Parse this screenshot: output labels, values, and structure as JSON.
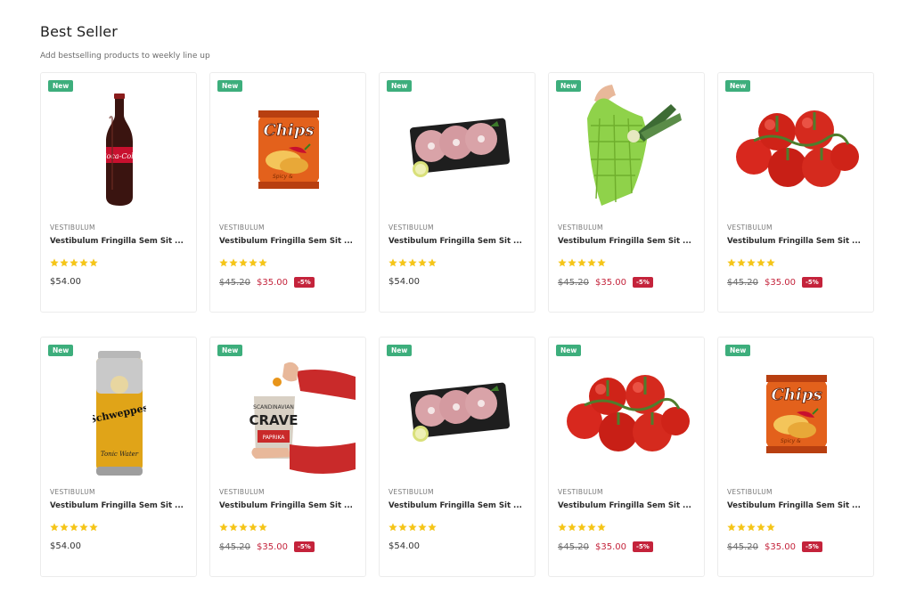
{
  "section": {
    "title": "Best Seller",
    "subtitle": "Add bestselling products to weekly line up"
  },
  "colors": {
    "new_badge": "#3dae7c",
    "sale": "#c4233b",
    "star": "#f5c518"
  },
  "products": [
    {
      "badge": "New",
      "image": "cola-bottle",
      "vendor": "VESTIBULUM",
      "name": "Vestibulum Fringilla Sem Sit ...",
      "rating": 5,
      "price": "$54.00",
      "old_price": "",
      "sale_price": "",
      "discount": ""
    },
    {
      "badge": "New",
      "image": "chips-bag",
      "vendor": "VESTIBULUM",
      "name": "Vestibulum Fringilla Sem Sit ...",
      "rating": 5,
      "price": "",
      "old_price": "$45.20",
      "sale_price": "$35.00",
      "discount": "-5%"
    },
    {
      "badge": "New",
      "image": "fish-steaks-tray",
      "vendor": "VESTIBULUM",
      "name": "Vestibulum Fringilla Sem Sit ...",
      "rating": 5,
      "price": "$54.00",
      "old_price": "",
      "sale_price": "",
      "discount": ""
    },
    {
      "badge": "New",
      "image": "mesh-grocery-bag",
      "vendor": "VESTIBULUM",
      "name": "Vestibulum Fringilla Sem Sit ...",
      "rating": 5,
      "price": "",
      "old_price": "$45.20",
      "sale_price": "$35.00",
      "discount": "-5%"
    },
    {
      "badge": "New",
      "image": "tomatoes-on-vine",
      "vendor": "VESTIBULUM",
      "name": "Vestibulum Fringilla Sem Sit ...",
      "rating": 5,
      "price": "",
      "old_price": "$45.20",
      "sale_price": "$35.00",
      "discount": "-5%"
    },
    {
      "badge": "New",
      "image": "schweppes-can",
      "vendor": "VESTIBULUM",
      "name": "Vestibulum Fringilla Sem Sit ...",
      "rating": 5,
      "price": "$54.00",
      "old_price": "",
      "sale_price": "",
      "discount": ""
    },
    {
      "badge": "New",
      "image": "crave-chips-hands",
      "vendor": "VESTIBULUM",
      "name": "Vestibulum Fringilla Sem Sit ...",
      "rating": 5,
      "price": "",
      "old_price": "$45.20",
      "sale_price": "$35.00",
      "discount": "-5%"
    },
    {
      "badge": "New",
      "image": "fish-steaks-tray",
      "vendor": "VESTIBULUM",
      "name": "Vestibulum Fringilla Sem Sit ...",
      "rating": 5,
      "price": "$54.00",
      "old_price": "",
      "sale_price": "",
      "discount": ""
    },
    {
      "badge": "New",
      "image": "tomatoes-on-vine",
      "vendor": "VESTIBULUM",
      "name": "Vestibulum Fringilla Sem Sit ...",
      "rating": 5,
      "price": "",
      "old_price": "$45.20",
      "sale_price": "$35.00",
      "discount": "-5%"
    },
    {
      "badge": "New",
      "image": "chips-bag",
      "vendor": "VESTIBULUM",
      "name": "Vestibulum Fringilla Sem Sit ...",
      "rating": 5,
      "price": "",
      "old_price": "$45.20",
      "sale_price": "$35.00",
      "discount": "-5%"
    }
  ]
}
